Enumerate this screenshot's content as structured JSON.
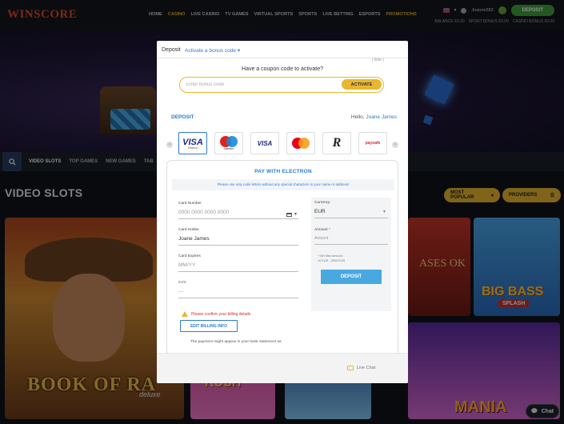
{
  "site": {
    "logo": "WINSCORE",
    "nav": [
      "HOME",
      "CASINO",
      "LIVE CASINO",
      "TV GAMES",
      "VIRTUAL SPORTS",
      "SPORTS",
      "LIVE BETTING",
      "ESPORTS",
      "PROMOTIONS"
    ],
    "active_nav": "CASINO",
    "username": "Joanne683",
    "deposit_label": "DEPOSIT",
    "balances": [
      "BALANCE €0.00",
      "SPORT BONUS €0.00",
      "CASINO BONUS €0.00"
    ],
    "categories": [
      "VIDEO SLOTS",
      "TOP GAMES",
      "NEW GAMES",
      "TAB"
    ],
    "section_title": "VIDEO SLOTS",
    "most_popular": "MOST POPULAR",
    "providers": "PROVIDERS",
    "tiles": {
      "book_of_ra": "BOOK OF RA",
      "book_of_ra_sub": "deluxe",
      "sugar_rush": "RUSH",
      "pharaoh": "ASES OK",
      "big_bass": "BIG BASS",
      "big_bass_splash": "SPLASH",
      "mania": "MANIA"
    },
    "chat_label": "Chat"
  },
  "modal": {
    "title": "Deposit",
    "bonus_link": "Activate a bonus code",
    "hide_link": "( hide )",
    "coupon_question": "Have a coupon code to activate?",
    "coupon_placeholder": "Enter bonus code",
    "activate_label": "ACTIVATE",
    "deposit_tab": "DEPOSIT",
    "hello_prefix": "Hello,",
    "user_name": "Joane James",
    "payment_methods": [
      {
        "name": "VISA",
        "sub": "Electron",
        "selected": true
      },
      {
        "name": "maestro",
        "selected": false
      },
      {
        "name": "VISA",
        "selected": false
      },
      {
        "name": "mastercard",
        "selected": false
      },
      {
        "name": "R",
        "selected": false
      },
      {
        "name": "paysafe",
        "selected": false
      }
    ],
    "pay_with": "PAY WITH ELECTRON",
    "notice": "Please use only Latin letters without any special characters in your name or address!",
    "card_number_label": "Card Number",
    "card_number_placeholder": "0000 0000 0000 0000",
    "card_holder_label": "Card Holder",
    "card_holder_value": "Joane James",
    "card_expires_label": "Card Expires",
    "card_expires_placeholder": "MM/YY",
    "cvv_label": "CVV",
    "cvv_value": "···",
    "currency_label": "Currency",
    "currency_value": "EUR",
    "amount_label": "Amount",
    "amount_placeholder": "Amount",
    "min_max_title": "* Min Max Amount:",
    "min_max_value": "10 EUR - 3000 EUR",
    "deposit_button": "DEPOSIT",
    "warning": "Please confirm your billing details",
    "edit_billing": "EDIT BILLING INFO",
    "bank_note": "The payment might appear in your bank statement as",
    "live_chat": "Live Chat"
  },
  "colors": {
    "accent": "#2b7bd0",
    "gold": "#e8b630",
    "deposit_green": "#41a33c",
    "warning_red": "#d62b2b"
  }
}
